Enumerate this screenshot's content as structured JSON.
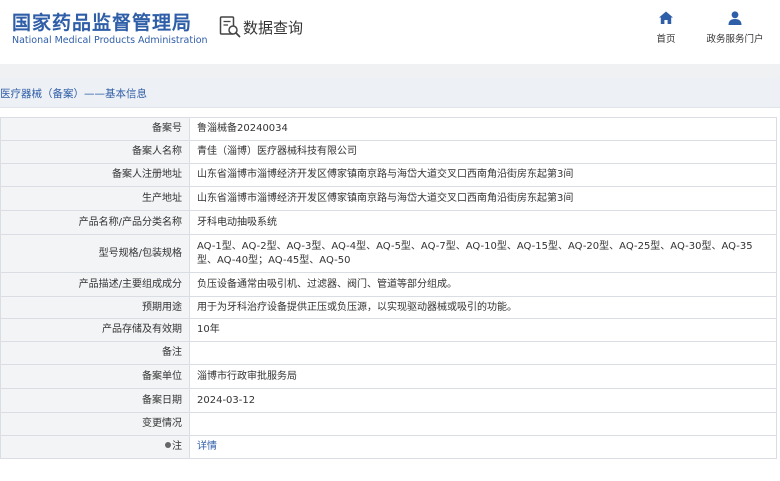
{
  "header": {
    "logo_cn": "国家药品监督管理局",
    "logo_en": "National Medical Products Administration",
    "query_title": "数据查询",
    "nav": [
      {
        "label": "首页",
        "icon": "home-icon"
      },
      {
        "label": "政务服务门户",
        "icon": "user-icon"
      }
    ]
  },
  "section": {
    "title": "医疗器械（备案）——基本信息"
  },
  "rows": [
    {
      "label": "备案号",
      "value": "鲁淄械备20240034"
    },
    {
      "label": "备案人名称",
      "value": "青佳（淄博）医疗器械科技有限公司"
    },
    {
      "label": "备案人注册地址",
      "value": "山东省淄博市淄博经济开发区傅家镇南京路与海岱大道交叉口西南角沿街房东起第3间"
    },
    {
      "label": "生产地址",
      "value": "山东省淄博市淄博经济开发区傅家镇南京路与海岱大道交叉口西南角沿街房东起第3间"
    },
    {
      "label": "产品名称/产品分类名称",
      "value": "牙科电动抽吸系统"
    },
    {
      "label": "型号规格/包装规格",
      "value": "AQ-1型、AQ-2型、AQ-3型、AQ-4型、AQ-5型、AQ-7型、AQ-10型、AQ-15型、AQ-20型、AQ-25型、AQ-30型、AQ-35型、AQ-40型；AQ-45型、AQ-50"
    },
    {
      "label": "产品描述/主要组成成分",
      "value": "负压设备通常由吸引机、过滤器、阀门、管道等部分组成。"
    },
    {
      "label": "预期用途",
      "value": "用于为牙科治疗设备提供正压或负压源，以实现驱动器械或吸引的功能。"
    },
    {
      "label": "产品存储及有效期",
      "value": "10年"
    },
    {
      "label": "备注",
      "value": ""
    },
    {
      "label": "备案单位",
      "value": "淄博市行政审批服务局"
    },
    {
      "label": "备案日期",
      "value": "2024-03-12"
    },
    {
      "label": "变更情况",
      "value": ""
    },
    {
      "label": "注",
      "value": "详情"
    }
  ],
  "colors": {
    "brand_blue": "#2f5ea8",
    "label_bg": "#f3f4f6",
    "section_bg": "#edf0f5",
    "border": "#dadde3"
  }
}
